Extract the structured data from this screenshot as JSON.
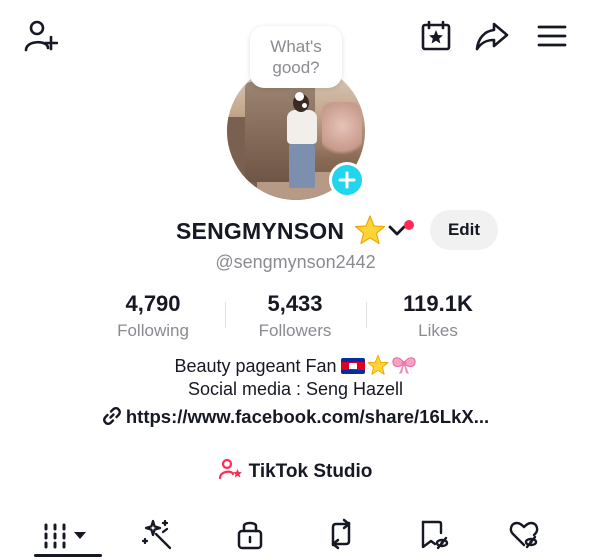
{
  "bubble": {
    "line1": "What's",
    "line2": "good?"
  },
  "profile": {
    "username": "SENGMYNSON",
    "handle": "@sengmynson2442",
    "edit_label": "Edit"
  },
  "stats": [
    {
      "value": "4,790",
      "label": "Following"
    },
    {
      "value": "5,433",
      "label": "Followers"
    },
    {
      "value": "119.1K",
      "label": "Likes"
    }
  ],
  "bio": {
    "line1": "Beauty pageant Fan",
    "line2": "Social media : Seng Hazell",
    "link": "https://www.facebook.com/share/16LkX..."
  },
  "studio": {
    "label": "TikTok Studio"
  },
  "icons": {
    "top_left": "add-friend-icon",
    "top_right": [
      "calendar-star-icon",
      "share-icon",
      "hamburger-menu-icon"
    ],
    "tabs": [
      "grid-videos-icon",
      "sparkle-wand-icon",
      "lock-icon",
      "repost-icon",
      "bookmark-icon",
      "liked-heart-icon"
    ]
  },
  "colors": {
    "accent_cyan": "#20d5ec",
    "notification_red": "#fe2c55",
    "text_primary": "#161823",
    "text_secondary": "#8a8b91"
  }
}
